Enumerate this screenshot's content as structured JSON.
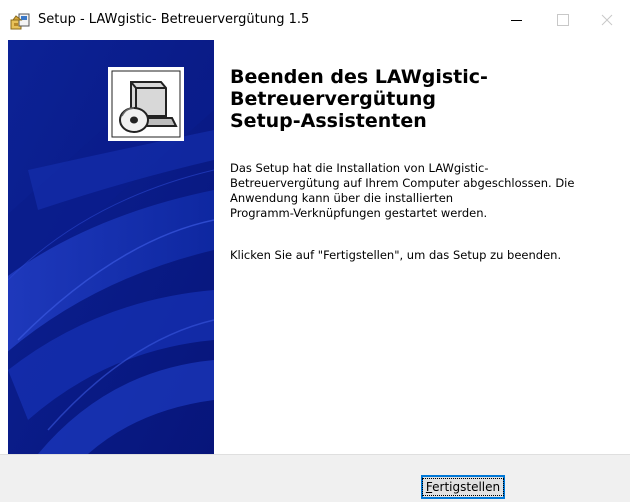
{
  "window": {
    "title": "Setup - LAWgistic- Betreuervergütung 1.5",
    "icons": {
      "app": "setup-package-icon",
      "minimize": "minimize-icon",
      "maximize": "maximize-icon",
      "close": "close-icon"
    }
  },
  "banner": {
    "icon": "computer-install-icon",
    "colors": {
      "background": "#0a1e8c",
      "accent": "#1a34b8"
    }
  },
  "content": {
    "heading": "Beenden des LAWgistic-\nBetreuervergütung\nSetup-Assistenten",
    "paragraph1": "Das Setup hat die Installation von LAWgistic-\nBetreuervergütung auf Ihrem Computer abgeschlossen. Die\nAnwendung kann über die installierten\nProgramm-Verknüpfungen gestartet werden.",
    "paragraph2": "Klicken Sie auf \"Fertigstellen\", um das Setup zu beenden."
  },
  "footer": {
    "finish_label": "Fertigstellen",
    "colors": {
      "focus_border": "#0078d7"
    }
  }
}
